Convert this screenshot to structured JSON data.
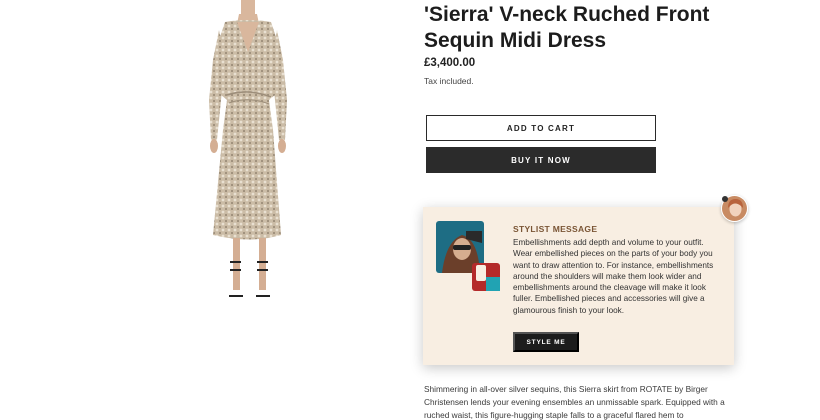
{
  "product": {
    "title": "'Sierra' V-neck Ruched Front Sequin Midi Dress",
    "price": "£3,400.00",
    "tax_note": "Tax included."
  },
  "actions": {
    "add_to_cart": "ADD TO CART",
    "buy_now": "BUY IT NOW"
  },
  "stylist": {
    "heading": "STYLIST MESSAGE",
    "message": "Embellishments add depth and volume to your outfit. Wear embellished pieces on the parts of your body you want to draw attention to. For instance, embellishments around the shoulders will make them look wider and embellishments around the cleavage will make it look fuller. Embellished pieces and accessories will give a glamourous finish to your look.",
    "style_button": "STYLE ME"
  },
  "description": "Shimmering in all-over silver sequins, this Sierra skirt from ROTATE by Birger Christensen lends your evening ensembles an unmissable spark. Equipped with a ruched waist, this figure-hugging staple falls to a graceful flared hem to",
  "colors": {
    "primary_button": "#2b2b2b",
    "card_background": "#f8eee2",
    "stylist_heading": "#7a5535"
  }
}
